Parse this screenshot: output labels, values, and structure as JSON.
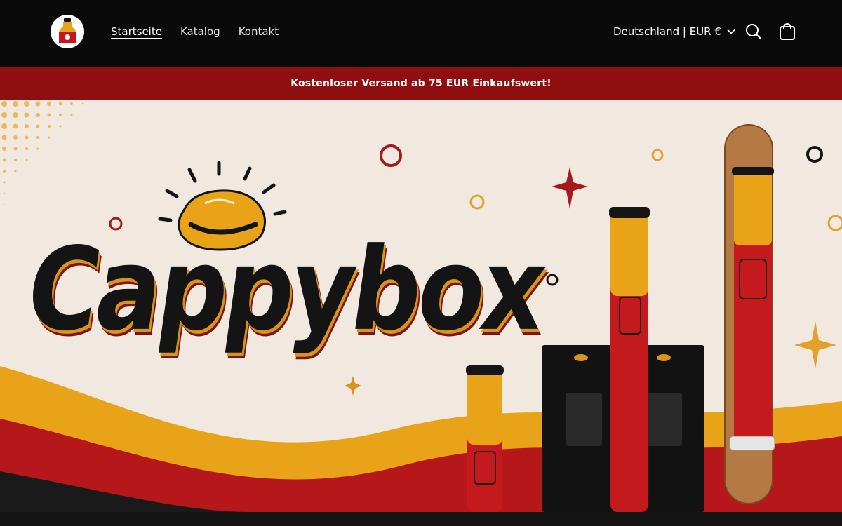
{
  "header": {
    "nav": [
      {
        "label": "Startseite",
        "active": true
      },
      {
        "label": "Katalog",
        "active": false
      },
      {
        "label": "Kontakt",
        "active": false
      }
    ],
    "locale_label": "Deutschland | EUR €",
    "icons": [
      "search-icon",
      "cart-icon",
      "chevron-down-icon"
    ]
  },
  "announcement": {
    "text": "Kostenloser Versand ab 75 EUR Einkaufswert!"
  },
  "hero": {
    "brand_text": "Cappybox"
  },
  "colors": {
    "header_bg": "#0a0a0a",
    "announcement_bg": "#8f0e10",
    "hero_bg": "#f1e9df",
    "accent_yellow": "#e9a318",
    "accent_red": "#b5171a"
  }
}
